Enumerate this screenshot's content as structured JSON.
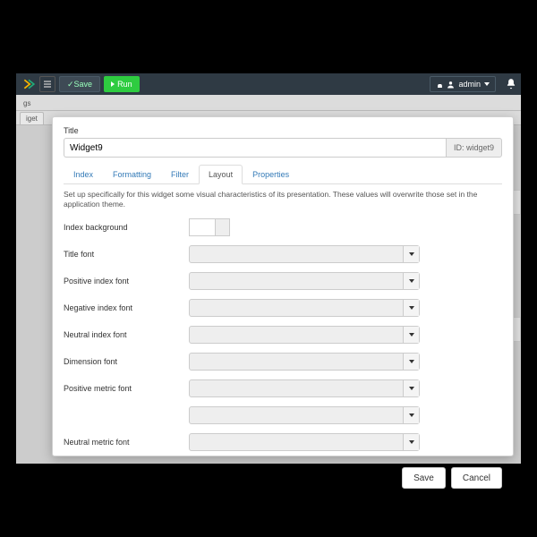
{
  "topbar": {
    "save_label": "Save",
    "run_label": "Run",
    "user_label": "admin"
  },
  "subhead": {
    "left": "gs",
    "tab": "iget"
  },
  "modal": {
    "title_label": "Title",
    "title_value": "Widget9",
    "id_label": "ID: widget9",
    "tabs": [
      "Index",
      "Formatting",
      "Filter",
      "Layout",
      "Properties"
    ],
    "active_tab": 3,
    "description": "Set up specifically for this widget some visual characteristics of its presentation. These values will overwrite those set in the application theme.",
    "rows": [
      {
        "label": "Index background",
        "type": "color"
      },
      {
        "label": "Title font",
        "type": "select"
      },
      {
        "label": "Positive index font",
        "type": "select"
      },
      {
        "label": "Negative index font",
        "type": "select"
      },
      {
        "label": "Neutral index font",
        "type": "select"
      },
      {
        "label": "Dimension font",
        "type": "select"
      },
      {
        "label": "Positive metric font",
        "type": "select"
      },
      {
        "label": "",
        "type": "select"
      },
      {
        "label": "Neutral metric font",
        "type": "select"
      }
    ],
    "save_label": "Save",
    "cancel_label": "Cancel"
  }
}
